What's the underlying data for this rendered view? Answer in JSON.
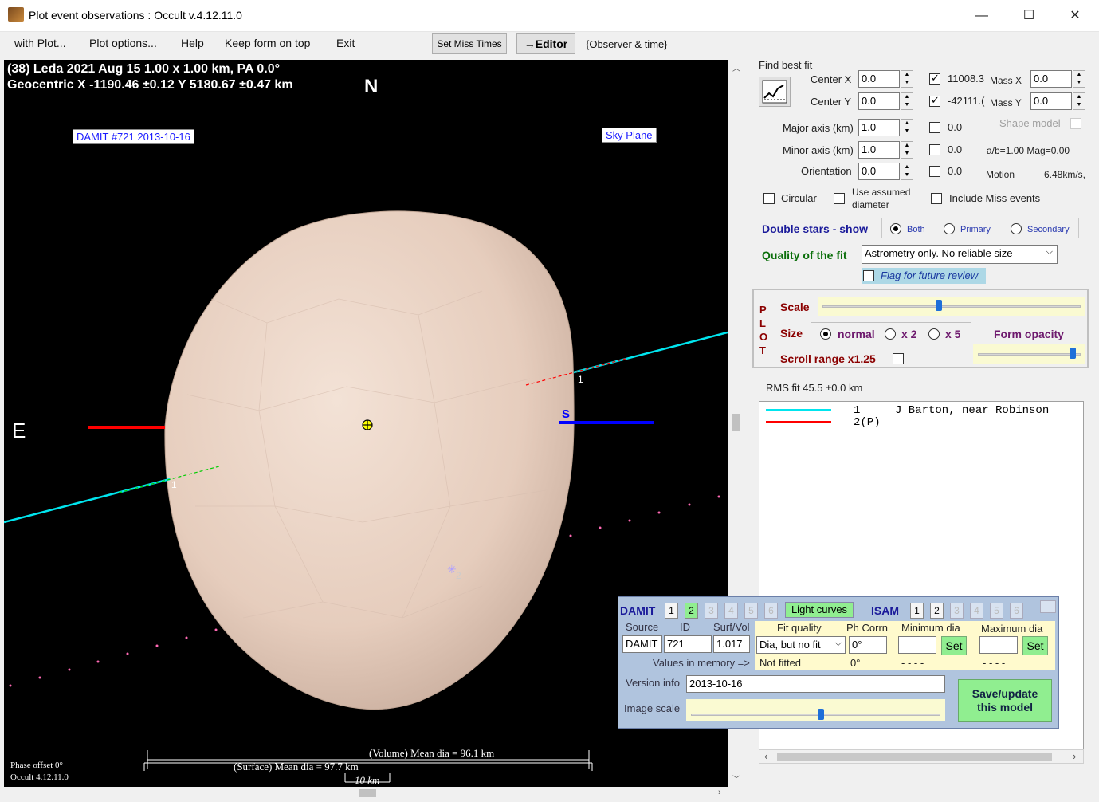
{
  "window": {
    "title": "Plot event observations : Occult v.4.12.11.0",
    "min": "—",
    "max": "☐",
    "close": "✕"
  },
  "menu": {
    "items": [
      "with Plot...",
      "Plot options...",
      "Help",
      "Keep form on top",
      "Exit"
    ],
    "set_miss_times": "Set Miss Times",
    "editor": "→Editor",
    "observer_time": "{Observer & time}"
  },
  "plot": {
    "header_line1": "(38) Leda  2021 Aug 15   1.00 x 1.00 km, PA 0.0°",
    "header_line2": "Geocentric  X  -1190.46 ±0.12  Y 5180.67 ±0.47 km",
    "north": "N",
    "east": "E",
    "south": "S",
    "damit_tag": "DAMIT #721 2013-10-16",
    "sky_plane": "Sky Plane",
    "chord_label_1a": "1",
    "chord_label_1b": "1",
    "chord_label_2": "2",
    "volume_caption": "(Volume) Mean dia = 96.1 km",
    "surface_caption": "(Surface) Mean dia = 97.7 km",
    "scale_caption": "10 km",
    "phase_offset": "Phase offset 0°",
    "occult_version": "Occult 4.12.11.0",
    "colors": {
      "chord1": "#00e5ee",
      "chord_red": "#ff0000",
      "chord_blue": "#0000ff",
      "body": "#e8d0c0"
    }
  },
  "fit": {
    "section": "Find best fit",
    "center_x_label": "Center X",
    "center_x": "0.0",
    "center_y_label": "Center Y",
    "center_y": "0.0",
    "mass_x_value": "11008.3",
    "mass_x_label": "Mass X",
    "mass_x": "0.0",
    "mass_y_value": "-42111.(",
    "mass_y_label": "Mass Y",
    "mass_y": "0.0",
    "major_label": "Major axis (km)",
    "major": "1.0",
    "major_cb": "0.0",
    "minor_label": "Minor axis (km)",
    "minor": "1.0",
    "minor_cb": "0.0",
    "orient_label": "Orientation",
    "orient": "0.0",
    "orient_cb": "0.0",
    "shape_model": "Shape model",
    "ab_mag": "a/b=1.00  Mag=0.00",
    "motion_label": "Motion",
    "motion_value": "6.48km/s,",
    "circular": "Circular",
    "use_assumed": "Use assumed",
    "diameter": "diameter",
    "include_miss": "Include Miss events"
  },
  "double_stars": {
    "label": "Double stars - show",
    "both": "Both",
    "primary": "Primary",
    "secondary": "Secondary"
  },
  "quality": {
    "label": "Quality of the fit",
    "value": "Astrometry only. No reliable size",
    "flag": "Flag for future review"
  },
  "plotbox": {
    "letters": [
      "P",
      "L",
      "O",
      "T"
    ],
    "scale": "Scale",
    "size": "Size",
    "normal": "normal",
    "x2": "x 2",
    "x5": "x 5",
    "form_opacity": "Form opacity",
    "scroll_range": "Scroll range x1.25",
    "scale_level": 0.45,
    "opacity_level": 0.95
  },
  "rms": "RMS fit 45.5 ±0.0 km",
  "legend": [
    {
      "num": "1",
      "text": "J Barton, near Robinson",
      "color": "#00e5ee"
    },
    {
      "num": "2(P)",
      "text": "",
      "color": "#ff0000"
    }
  ],
  "damit": {
    "title": "DAMIT",
    "nums": [
      "1",
      "2",
      "3",
      "4",
      "5",
      "6"
    ],
    "light_curves": "Light curves",
    "isam": "ISAM",
    "source_label": "Source",
    "id_label": "ID",
    "surfvol_label": "Surf/Vol",
    "source": "DAMIT",
    "id": "721",
    "surfvol": "1.017",
    "fit_quality_label": "Fit quality",
    "fit_quality": "Dia, but no fit",
    "ph_corrn_label": "Ph Corrn",
    "ph_corrn": "0°",
    "min_dia_label": "Minimum dia",
    "max_dia_label": "Maximum dia",
    "set": "Set",
    "values_memory": "Values in memory =>",
    "mem_fit": "Not fitted",
    "mem_ph": "0°",
    "mem_min": "- - - -",
    "mem_max": "- - - -",
    "version_label": "Version info",
    "version": "2013-10-16",
    "image_scale_label": "Image scale",
    "image_scale_level": 0.52,
    "save": "Save/update\nthis model"
  }
}
